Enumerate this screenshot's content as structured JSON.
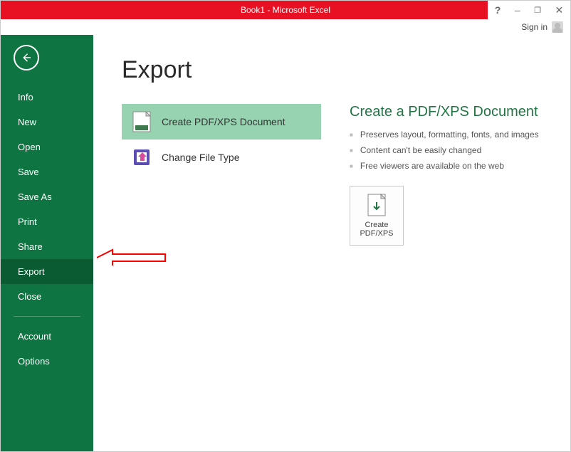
{
  "titlebar": {
    "title": "Book1 - Microsoft Excel"
  },
  "signin": {
    "label": "Sign in"
  },
  "sidebar": {
    "items": [
      {
        "label": "Info"
      },
      {
        "label": "New"
      },
      {
        "label": "Open"
      },
      {
        "label": "Save"
      },
      {
        "label": "Save As"
      },
      {
        "label": "Print"
      },
      {
        "label": "Share"
      },
      {
        "label": "Export"
      },
      {
        "label": "Close"
      }
    ],
    "footer": [
      {
        "label": "Account"
      },
      {
        "label": "Options"
      }
    ],
    "selected_index": 7
  },
  "page": {
    "title": "Export"
  },
  "export_options": [
    {
      "label": "Create PDF/XPS Document",
      "icon": "pdf"
    },
    {
      "label": "Change File Type",
      "icon": "filetype"
    }
  ],
  "export_selected_index": 0,
  "detail": {
    "heading": "Create a PDF/XPS Document",
    "bullets": [
      "Preserves layout, formatting, fonts, and images",
      "Content can't be easily changed",
      "Free viewers are available on the web"
    ],
    "button_line1": "Create",
    "button_line2": "PDF/XPS"
  }
}
